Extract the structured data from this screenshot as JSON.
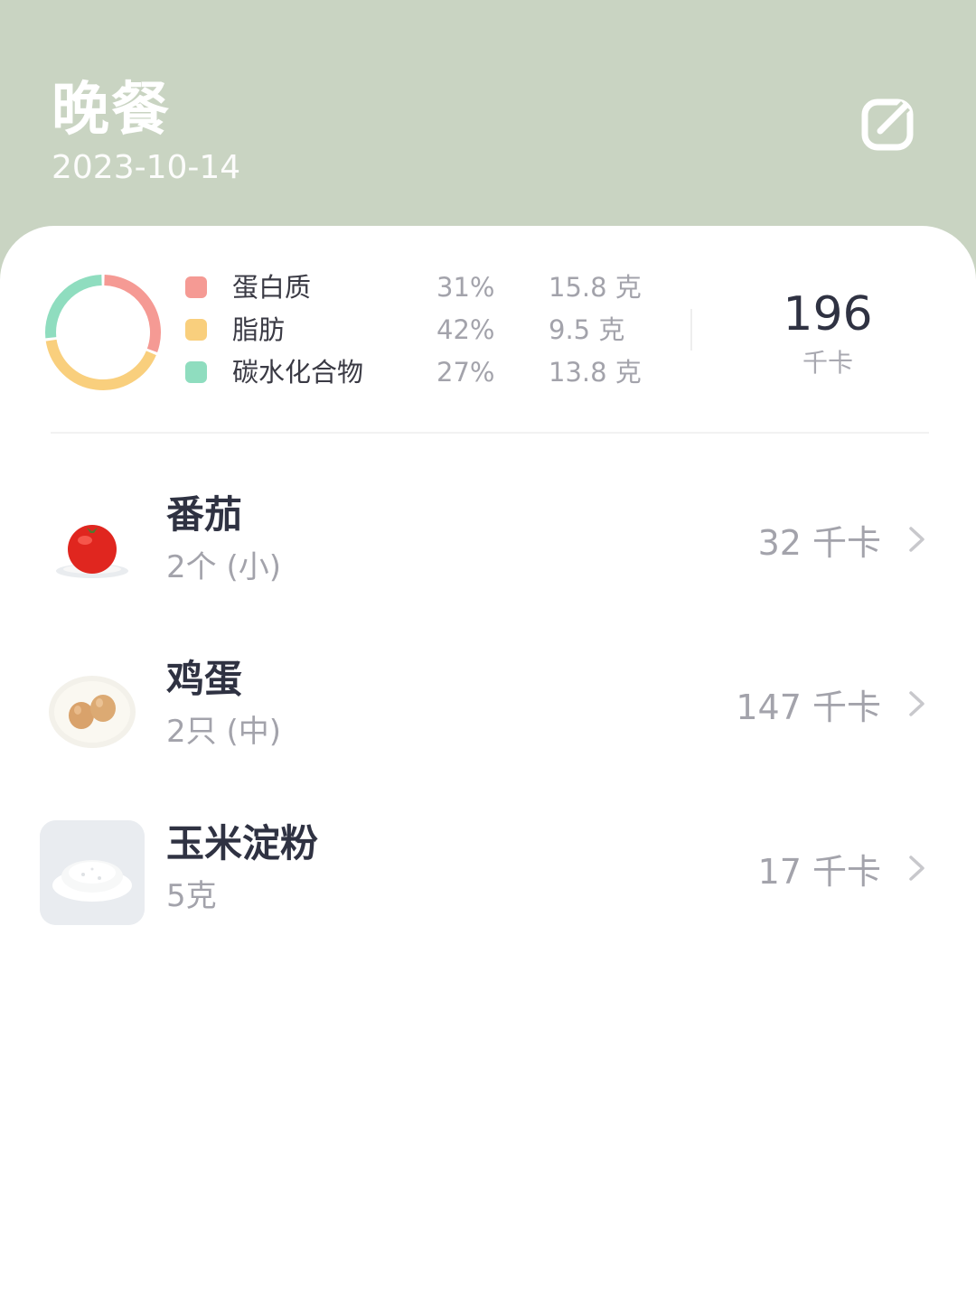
{
  "header": {
    "title": "晚餐",
    "date": "2023-10-14"
  },
  "summary": {
    "macros": [
      {
        "name": "蛋白质",
        "percent": "31%",
        "amount": "15.8 克",
        "color": "#f59a94"
      },
      {
        "name": "脂肪",
        "percent": "42%",
        "amount": "9.5 克",
        "color": "#f9cf7d"
      },
      {
        "name": "碳水化合物",
        "percent": "27%",
        "amount": "13.8 克",
        "color": "#8fddbf"
      }
    ],
    "total_kcal": "196",
    "kcal_unit": "千卡"
  },
  "foods": [
    {
      "name": "番茄",
      "quantity": "2个 (小)",
      "kcal": "32 千卡",
      "icon": "tomato-icon"
    },
    {
      "name": "鸡蛋",
      "quantity": "2只 (中)",
      "kcal": "147 千卡",
      "icon": "eggs-icon"
    },
    {
      "name": "玉米淀粉",
      "quantity": "5克",
      "kcal": "17 千卡",
      "icon": "cornstarch-icon"
    }
  ],
  "colors": {
    "header_bg": "#c9d4c2",
    "card_bg": "#ffffff",
    "primary_text": "#2f3242",
    "secondary_text": "#a3a3ab"
  }
}
